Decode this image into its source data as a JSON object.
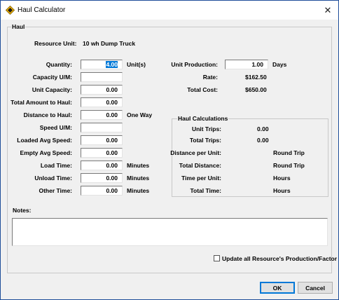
{
  "window": {
    "title": "Haul Calculator",
    "close_glyph": "✕"
  },
  "haul": {
    "group_title": "Haul",
    "resource_unit_label": "Resource Unit:",
    "resource_unit_value": "10 wh Dump Truck",
    "quantity_label": "Quantity:",
    "quantity_value": "4.00",
    "quantity_unit": "Unit(s)",
    "capacity_um_label": "Capacity U/M:",
    "capacity_um_value": "",
    "unit_capacity_label": "Unit Capacity:",
    "unit_capacity_value": "0.00",
    "total_amount_label": "Total Amount to Haul:",
    "total_amount_value": "0.00",
    "distance_label": "Distance to Haul:",
    "distance_value": "0.00",
    "distance_unit": "One Way",
    "speed_um_label": "Speed U/M:",
    "speed_um_value": "",
    "loaded_speed_label": "Loaded Avg Speed:",
    "loaded_speed_value": "0.00",
    "empty_speed_label": "Empty Avg Speed:",
    "empty_speed_value": "0.00",
    "load_time_label": "Load Time:",
    "load_time_value": "0.00",
    "load_time_unit": "Minutes",
    "unload_time_label": "Unload Time:",
    "unload_time_value": "0.00",
    "unload_time_unit": "Minutes",
    "other_time_label": "Other Time:",
    "other_time_value": "0.00",
    "other_time_unit": "Minutes",
    "unit_production_label": "Unit Production:",
    "unit_production_value": "1.00",
    "unit_production_unit": "Days",
    "rate_label": "Rate:",
    "rate_value": "$162.50",
    "total_cost_label": "Total Cost:",
    "total_cost_value": "$650.00"
  },
  "haul_calculations": {
    "group_title": "Haul Calculations",
    "unit_trips_label": "Unit Trips:",
    "unit_trips_value": "0.00",
    "total_trips_label": "Total Trips:",
    "total_trips_value": "0.00",
    "distance_per_unit_label": "Distance per Unit:",
    "distance_per_unit_value": "Round Trip",
    "total_distance_label": "Total Distance:",
    "total_distance_value": "Round Trip",
    "time_per_unit_label": "Time per Unit:",
    "time_per_unit_value": "Hours",
    "total_time_label": "Total Time:",
    "total_time_value": "Hours"
  },
  "notes": {
    "label": "Notes:",
    "value": ""
  },
  "update_all": {
    "label": "Update all Resource's Production/Factor",
    "checked": false
  },
  "buttons": {
    "ok": "OK",
    "cancel": "Cancel"
  }
}
